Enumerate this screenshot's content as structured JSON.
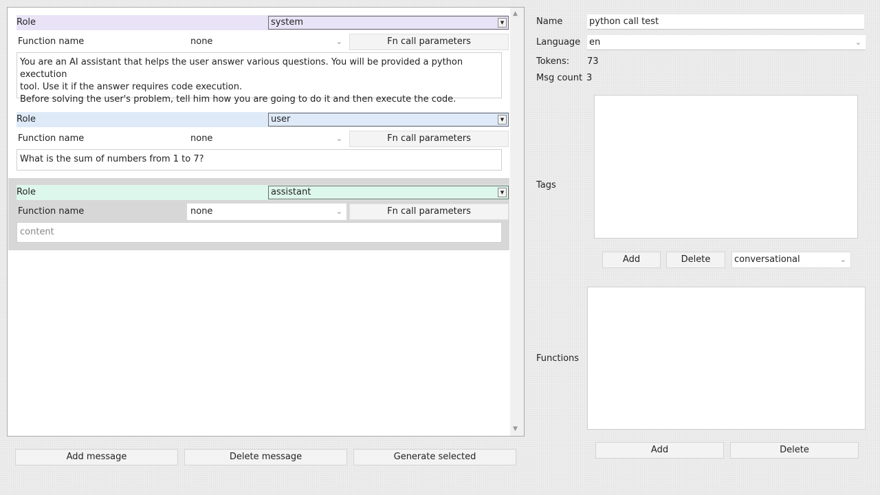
{
  "messages": [
    {
      "role_label": "Role",
      "role_value": "system",
      "role_color": "#e9e3f7",
      "fn_label": "Function name",
      "fn_value": "none",
      "fn_button": "Fn call parameters",
      "content_lines": [
        "You are an AI assistant that helps the user answer various questions. You will be provided a python exectution",
        "tool. Use it if the answer requires code execution.",
        "Before solving the user's problem, tell him how you are going to do it and then execute the code."
      ]
    },
    {
      "role_label": "Role",
      "role_value": "user",
      "role_color": "#dfeaf8",
      "fn_label": "Function name",
      "fn_value": "none",
      "fn_button": "Fn call parameters",
      "content_lines": [
        "What is the sum of numbers from 1 to 7?"
      ]
    },
    {
      "role_label": "Role",
      "role_value": "assistant",
      "role_color": "#def7ec",
      "fn_label": "Function name",
      "fn_value": "none",
      "fn_button": "Fn call parameters",
      "content_placeholder": "content"
    }
  ],
  "bottom_buttons": {
    "add": "Add message",
    "delete": "Delete message",
    "generate": "Generate selected"
  },
  "sidebar": {
    "name_label": "Name",
    "name_value": "python call test",
    "language_label": "Language",
    "language_value": "en",
    "tokens_label": "Tokens:",
    "tokens_value": "73",
    "msgcount_label": "Msg count",
    "msgcount_value": "3",
    "tags_label": "Tags",
    "tags_add": "Add",
    "tags_delete": "Delete",
    "tags_select": "conversational",
    "functions_label": "Functions",
    "functions_add": "Add",
    "functions_delete": "Delete"
  },
  "icons": {
    "dropdown": "dropdown-arrow-icon",
    "chevron": "chevron-down-icon",
    "scroll_up": "scroll-up-icon",
    "scroll_down": "scroll-down-icon"
  }
}
